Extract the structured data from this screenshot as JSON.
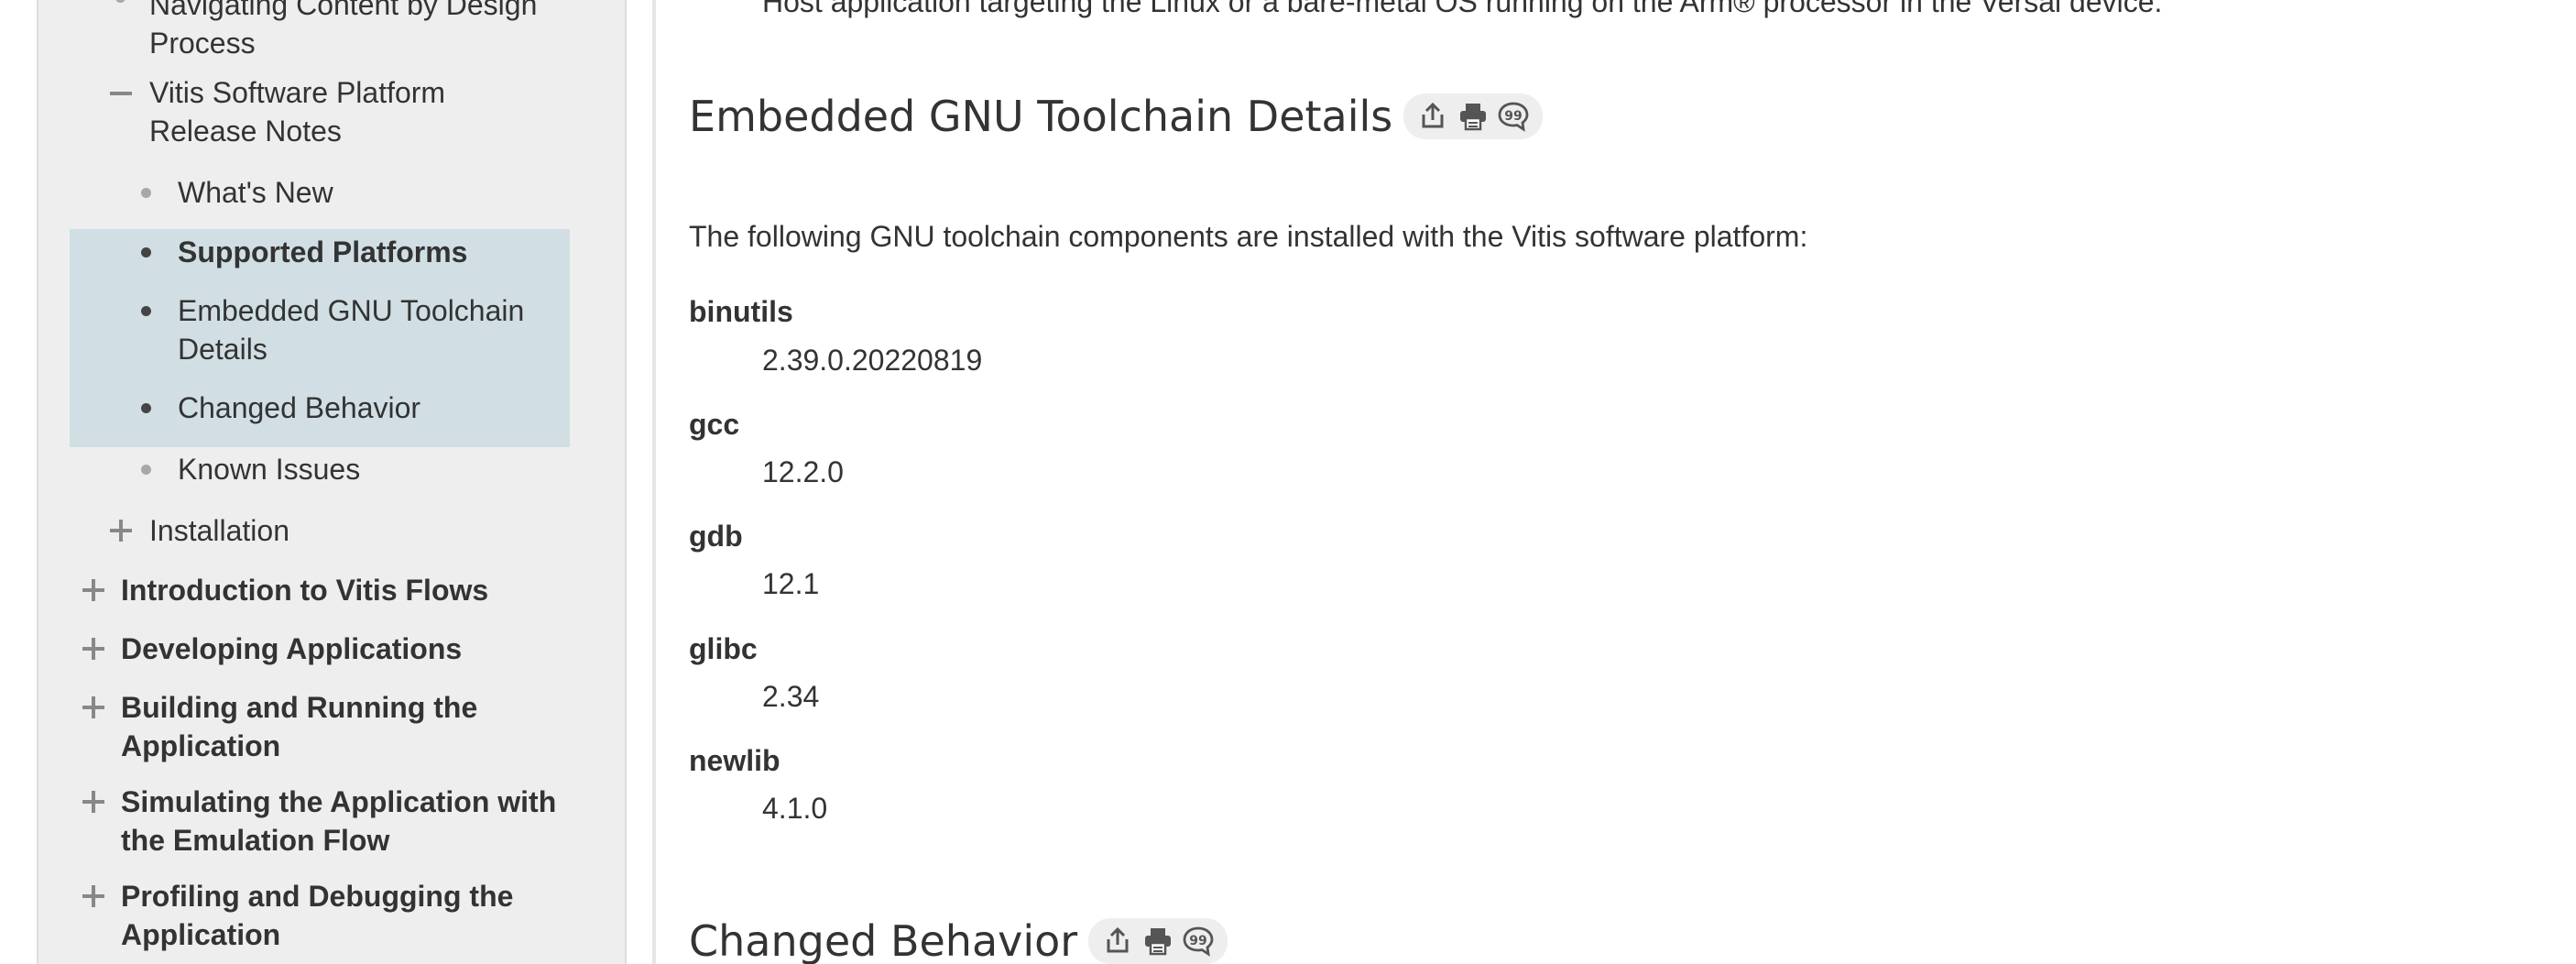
{
  "sidebar": {
    "items": [
      {
        "label": "Navigating Content by Design Process",
        "marker": "bullet",
        "bold": false
      },
      {
        "label": "Vitis Software Platform Release Notes",
        "marker": "minus",
        "bold": false
      },
      {
        "label": "What's New",
        "marker": "bullet",
        "bold": false
      },
      {
        "label": "Supported Platforms",
        "marker": "bullet",
        "bold": true
      },
      {
        "label": "Embedded GNU Toolchain Details",
        "marker": "bullet",
        "bold": false
      },
      {
        "label": "Changed Behavior",
        "marker": "bullet",
        "bold": false
      },
      {
        "label": "Known Issues",
        "marker": "bullet",
        "bold": false
      },
      {
        "label": "Installation",
        "marker": "plus",
        "bold": false
      },
      {
        "label": "Introduction to Vitis Flows",
        "marker": "plus",
        "bold": true
      },
      {
        "label": "Developing Applications",
        "marker": "plus",
        "bold": true
      },
      {
        "label": "Building and Running the Application",
        "marker": "plus",
        "bold": true
      },
      {
        "label": "Simulating the Application with the Emulation Flow",
        "marker": "plus",
        "bold": true
      },
      {
        "label": "Profiling and Debugging the Application",
        "marker": "plus",
        "bold": true
      }
    ]
  },
  "main": {
    "partial_line": "Host application targeting the Linux or a bare-metal OS running on the Arm® processor in the Versal device.",
    "sections": [
      {
        "heading": "Embedded GNU Toolchain Details",
        "intro": "The following GNU toolchain components are installed with the Vitis software platform:",
        "components": [
          {
            "name": "binutils",
            "version": "2.39.0.20220819"
          },
          {
            "name": "gcc",
            "version": "12.2.0"
          },
          {
            "name": "gdb",
            "version": "12.1"
          },
          {
            "name": "glibc",
            "version": "2.34"
          },
          {
            "name": "newlib",
            "version": "4.1.0"
          }
        ]
      },
      {
        "heading": "Changed Behavior"
      }
    ],
    "section_icons": [
      "share-icon",
      "print-icon",
      "feedback-icon"
    ]
  }
}
